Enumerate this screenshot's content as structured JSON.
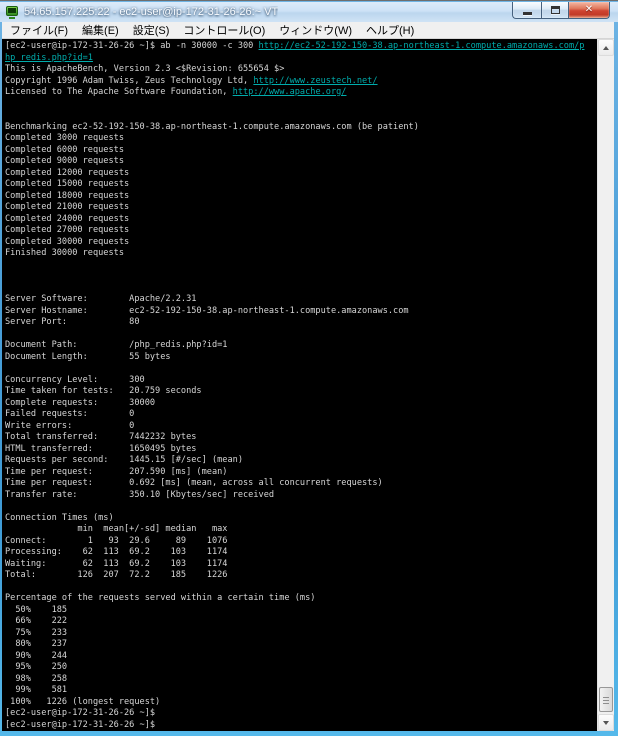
{
  "window": {
    "title": "54.65.157.225:22 - ec2-user@ip-172-31-26-26:~ VT",
    "app_icon": "teraterm-terminal-icon",
    "controls": [
      {
        "name": "minimize"
      },
      {
        "name": "maximize"
      },
      {
        "name": "close"
      }
    ]
  },
  "menu": {
    "items": [
      "ファイル(F)",
      "編集(E)",
      "設定(S)",
      "コントロール(O)",
      "ウィンドウ(W)",
      "ヘルプ(H)"
    ]
  },
  "colors": {
    "terminal_background": "#000000",
    "terminal_text": "#d6d6d6",
    "terminal_link": "#00acac",
    "titlebar_glass": "#cde2f6",
    "close_button_red": "#cf4331",
    "window_border_blue": "#4a9fd8"
  },
  "terminal": {
    "lines": [
      [
        {
          "t": "[ec2-user@ip-172-31-26-26 ~]$ ab -n 30000 -c 300 "
        },
        {
          "t": "http://ec2-52-192-150-38.ap-northeast-1.compute.amazonaws.com/p",
          "link": true
        }
      ],
      [
        {
          "t": "hp_redis.php?id=1",
          "link": true
        }
      ],
      [
        {
          "t": "This is ApacheBench, Version 2.3 <$Revision: 655654 $>"
        }
      ],
      [
        {
          "t": "Copyright 1996 Adam Twiss, Zeus Technology Ltd, "
        },
        {
          "t": "http://www.zeustech.net/",
          "link": true
        }
      ],
      [
        {
          "t": "Licensed to The Apache Software Foundation, "
        },
        {
          "t": "http://www.apache.org/",
          "link": true
        }
      ],
      [],
      [],
      [
        {
          "t": "Benchmarking ec2-52-192-150-38.ap-northeast-1.compute.amazonaws.com (be patient)"
        }
      ],
      [
        {
          "t": "Completed 3000 requests"
        }
      ],
      [
        {
          "t": "Completed 6000 requests"
        }
      ],
      [
        {
          "t": "Completed 9000 requests"
        }
      ],
      [
        {
          "t": "Completed 12000 requests"
        }
      ],
      [
        {
          "t": "Completed 15000 requests"
        }
      ],
      [
        {
          "t": "Completed 18000 requests"
        }
      ],
      [
        {
          "t": "Completed 21000 requests"
        }
      ],
      [
        {
          "t": "Completed 24000 requests"
        }
      ],
      [
        {
          "t": "Completed 27000 requests"
        }
      ],
      [
        {
          "t": "Completed 30000 requests"
        }
      ],
      [
        {
          "t": "Finished 30000 requests"
        }
      ],
      [],
      [],
      [],
      [
        {
          "t": "Server Software:        Apache/2.2.31"
        }
      ],
      [
        {
          "t": "Server Hostname:        ec2-52-192-150-38.ap-northeast-1.compute.amazonaws.com"
        }
      ],
      [
        {
          "t": "Server Port:            80"
        }
      ],
      [],
      [
        {
          "t": "Document Path:          /php_redis.php?id=1"
        }
      ],
      [
        {
          "t": "Document Length:        55 bytes"
        }
      ],
      [],
      [
        {
          "t": "Concurrency Level:      300"
        }
      ],
      [
        {
          "t": "Time taken for tests:   20.759 seconds"
        }
      ],
      [
        {
          "t": "Complete requests:      30000"
        }
      ],
      [
        {
          "t": "Failed requests:        0"
        }
      ],
      [
        {
          "t": "Write errors:           0"
        }
      ],
      [
        {
          "t": "Total transferred:      7442232 bytes"
        }
      ],
      [
        {
          "t": "HTML transferred:       1650495 bytes"
        }
      ],
      [
        {
          "t": "Requests per second:    1445.15 [#/sec] (mean)"
        }
      ],
      [
        {
          "t": "Time per request:       207.590 [ms] (mean)"
        }
      ],
      [
        {
          "t": "Time per request:       0.692 [ms] (mean, across all concurrent requests)"
        }
      ],
      [
        {
          "t": "Transfer rate:          350.10 [Kbytes/sec] received"
        }
      ],
      [],
      [
        {
          "t": "Connection Times (ms)"
        }
      ],
      [
        {
          "t": "              min  mean[+/-sd] median   max"
        }
      ],
      [
        {
          "t": "Connect:        1   93  29.6     89    1076"
        }
      ],
      [
        {
          "t": "Processing:    62  113  69.2    103    1174"
        }
      ],
      [
        {
          "t": "Waiting:       62  113  69.2    103    1174"
        }
      ],
      [
        {
          "t": "Total:        126  207  72.2    185    1226"
        }
      ],
      [],
      [
        {
          "t": "Percentage of the requests served within a certain time (ms)"
        }
      ],
      [
        {
          "t": "  50%    185"
        }
      ],
      [
        {
          "t": "  66%    222"
        }
      ],
      [
        {
          "t": "  75%    233"
        }
      ],
      [
        {
          "t": "  80%    237"
        }
      ],
      [
        {
          "t": "  90%    244"
        }
      ],
      [
        {
          "t": "  95%    250"
        }
      ],
      [
        {
          "t": "  98%    258"
        }
      ],
      [
        {
          "t": "  99%    581"
        }
      ],
      [
        {
          "t": " 100%   1226 (longest request)"
        }
      ],
      [
        {
          "t": "[ec2-user@ip-172-31-26-26 ~]$"
        }
      ],
      [
        {
          "t": "[ec2-user@ip-172-31-26-26 ~]$"
        }
      ]
    ]
  }
}
